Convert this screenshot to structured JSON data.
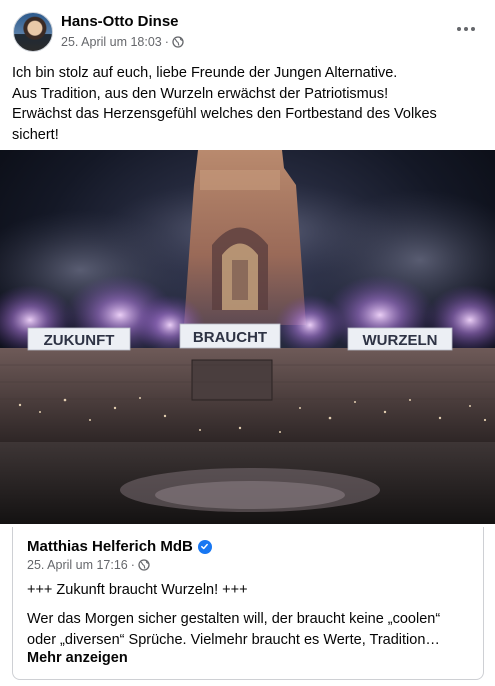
{
  "post": {
    "author": "Hans-Otto Dinse",
    "timestamp": "25. April um 18:03",
    "separator": "·",
    "audience_icon": "globe-icon",
    "more_icon": "ellipsis-icon",
    "text_lines": [
      "Ich bin stolz auf euch, liebe Freunde der Jungen Alternative.",
      "Aus Tradition, aus den Wurzeln erwächst der Patriotismus!",
      "Erwächst das Herzensgefühl welches den Fortbestand des Volkes",
      "sichert!"
    ]
  },
  "photo": {
    "banners": [
      "ZUKUNFT",
      "BRAUCHT",
      "WURZELN"
    ]
  },
  "shared": {
    "author": "Matthias Helferich MdB",
    "verified_icon": "verified-badge-icon",
    "timestamp": "25. April um 17:16",
    "separator": "·",
    "audience_icon": "globe-icon",
    "headline": "+++ Zukunft braucht Wurzeln! +++",
    "body_lines": [
      "Wer das Morgen sicher gestalten will, der braucht keine „coolen“",
      "oder „diversen“ Sprüche. Vielmehr braucht es Werte, Tradition…"
    ],
    "see_more": "Mehr anzeigen"
  },
  "colors": {
    "text": "#050505",
    "secondary": "#65676b",
    "verified": "#1877f2",
    "border": "#ced0d4"
  }
}
